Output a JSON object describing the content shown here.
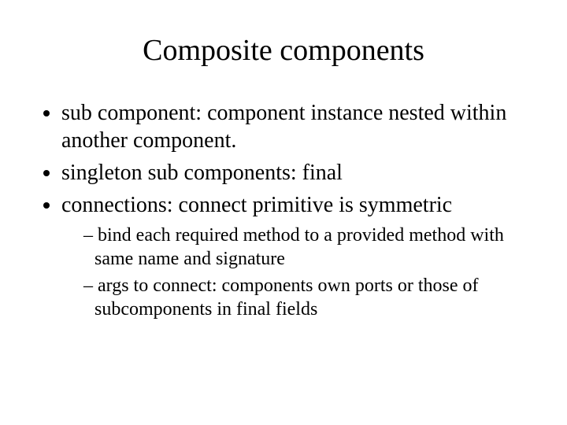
{
  "title": "Composite components",
  "bullets": [
    "sub component: component instance nested within another component.",
    "singleton sub components: final",
    "connections: connect primitive is symmetric"
  ],
  "subbullets": [
    "bind each required method to a provided method with  same name and signature",
    "args to connect: components own ports or those of subcomponents in final fields"
  ]
}
